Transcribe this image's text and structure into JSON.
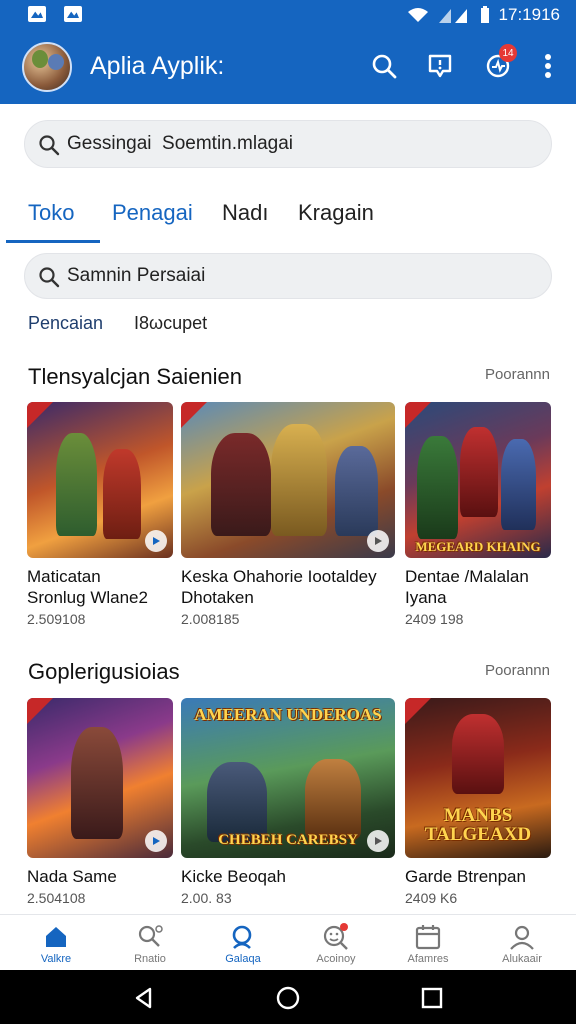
{
  "status": {
    "time": "17:1916"
  },
  "app": {
    "title": "Aplia Ayplik:",
    "notif_count": "14"
  },
  "search_top": {
    "value": "Gessingai  Soemtin.mlagai"
  },
  "tabs": [
    {
      "label": "Toko"
    },
    {
      "label": "Penagai"
    },
    {
      "label": "Nadı"
    },
    {
      "label": "Kragain"
    }
  ],
  "search_secondary": {
    "value": "Samnin Persaiai"
  },
  "chips": [
    {
      "label": "Pencaian"
    },
    {
      "label": "Ι8ωcupet"
    }
  ],
  "sections": [
    {
      "title": "Tlensyalcjan Saienien",
      "more": "Poorannn",
      "cards": [
        {
          "name_line1": "Maticatan",
          "name_line2": "Sronlug Wlane2",
          "meta": "2.509108"
        },
        {
          "name_line1": "Keska Ohahorie Iootaldey",
          "name_line2": "Dhotaken",
          "meta": "2.008185"
        },
        {
          "name_line1": "Dentae /Malalan",
          "name_line2": "Iyana",
          "meta": "2409 198",
          "art_text": "MEGEARD KHAING"
        }
      ]
    },
    {
      "title": "Goplerigusioias",
      "more": "Poorannn",
      "cards": [
        {
          "name_line1": "Nada Same",
          "meta": "2.504108"
        },
        {
          "name_line1": "Kicke Beoqah",
          "meta": "2.00. 83",
          "art_text_top": "AMEERAN UNDEROAS",
          "art_text_bottom": "CHEBEH CAREBSY"
        },
        {
          "name_line1": "Garde Btrenpan",
          "meta": "2409 K6",
          "art_text": "MANBS TALGEAXD"
        }
      ]
    }
  ],
  "bottom_nav": [
    {
      "label": "Valkre",
      "icon": "home-icon"
    },
    {
      "label": "Rnatio",
      "icon": "search-person-icon"
    },
    {
      "label": "Galaqa",
      "icon": "search-icon"
    },
    {
      "label": "Acoinoy",
      "icon": "face-search-icon"
    },
    {
      "label": "Afamres",
      "icon": "calendar-icon"
    },
    {
      "label": "Alukaair",
      "icon": "person-icon"
    }
  ],
  "colors": {
    "primary": "#1565c0",
    "badge": "#e53935",
    "surface": "#eef0f2"
  }
}
